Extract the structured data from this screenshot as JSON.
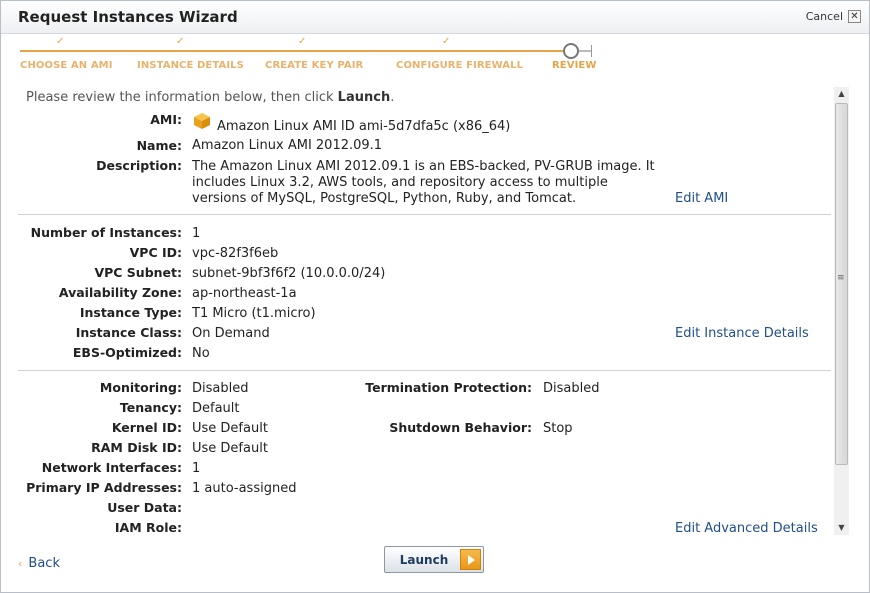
{
  "window": {
    "title": "Request Instances Wizard",
    "cancel_label": "Cancel",
    "close_glyph": "✕"
  },
  "steps": [
    {
      "label": "CHOOSE AN AMI",
      "status": "complete"
    },
    {
      "label": "INSTANCE DETAILS",
      "status": "complete"
    },
    {
      "label": "CREATE KEY PAIR",
      "status": "complete"
    },
    {
      "label": "CONFIGURE FIREWALL",
      "status": "complete"
    },
    {
      "label": "REVIEW",
      "status": "current"
    }
  ],
  "intro": {
    "prefix": "Please review the information below, then click ",
    "action": "Launch",
    "suffix": "."
  },
  "ami_section": {
    "ami_label": "AMI:",
    "ami_value": "Amazon Linux AMI ID ami-5d7dfa5c (x86_64)",
    "name_label": "Name:",
    "name_value": "Amazon Linux AMI 2012.09.1",
    "description_label": "Description:",
    "description_lines": [
      "The Amazon Linux AMI 2012.09.1 is an EBS-backed, PV-GRUB image. It",
      "includes Linux 3.2, AWS tools, and repository access to multiple",
      "versions of MySQL, PostgreSQL, Python, Ruby, and Tomcat."
    ],
    "edit_label": "Edit AMI"
  },
  "instance_section": {
    "rows": [
      {
        "label": "Number of Instances:",
        "value": "1"
      },
      {
        "label": "VPC ID:",
        "value": "vpc-82f3f6eb"
      },
      {
        "label": "VPC Subnet:",
        "value": "subnet-9bf3f6f2 (10.0.0.0/24)"
      },
      {
        "label": "Availability Zone:",
        "value": "ap-northeast-1a"
      },
      {
        "label": "Instance Type:",
        "value": "T1 Micro (t1.micro)"
      },
      {
        "label": "Instance Class:",
        "value": "On Demand"
      },
      {
        "label": "EBS-Optimized:",
        "value": "No"
      }
    ],
    "edit_label": "Edit Instance Details"
  },
  "advanced_section": {
    "rows": [
      {
        "label": "Monitoring:",
        "value": "Disabled"
      },
      {
        "label": "Tenancy:",
        "value": "Default"
      },
      {
        "label": "Kernel ID:",
        "value": "Use Default"
      },
      {
        "label": "RAM Disk ID:",
        "value": "Use Default"
      },
      {
        "label": "Network Interfaces:",
        "value": "1"
      },
      {
        "label": "Primary IP Addresses:",
        "value": "1 auto-assigned"
      },
      {
        "label": "User Data:",
        "value": ""
      },
      {
        "label": "IAM Role:",
        "value": ""
      }
    ],
    "right_rows": [
      {
        "label": "Termination Protection:",
        "value": "Disabled"
      },
      {
        "label": "Shutdown Behavior:",
        "value": "Stop"
      }
    ],
    "edit_label": "Edit Advanced Details"
  },
  "footer": {
    "back_label": "Back",
    "launch_label": "Launch"
  },
  "colors": {
    "accent_orange": "#e3a54a",
    "link_blue": "#1f4e8c"
  }
}
